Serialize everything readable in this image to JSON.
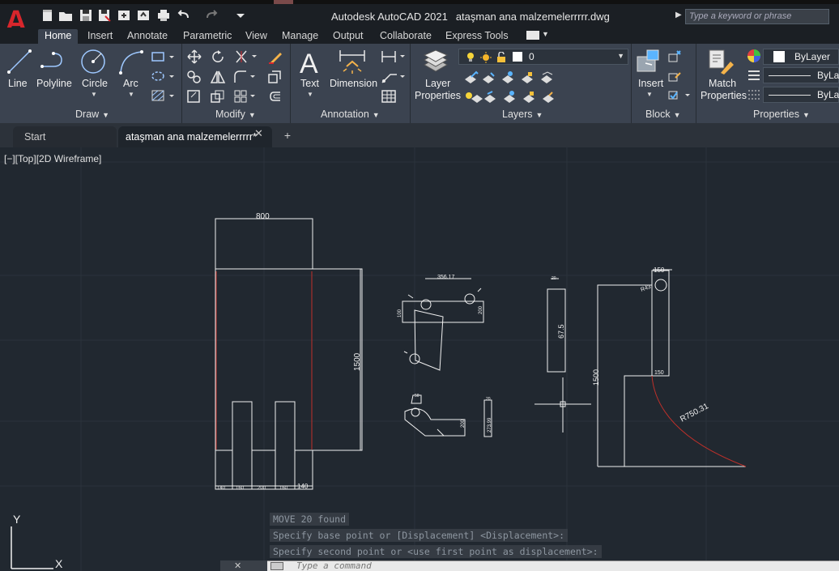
{
  "app": {
    "logo": "A",
    "title": "Autodesk AutoCAD 2021",
    "filename": "ataşman ana malzemelerrrrr.dwg",
    "search_placeholder": "Type a keyword or phrase"
  },
  "ribbon_tabs": [
    "Home",
    "Insert",
    "Annotate",
    "Parametric",
    "View",
    "Manage",
    "Output",
    "Collaborate",
    "Express Tools"
  ],
  "panels": {
    "draw": {
      "title": "Draw",
      "tools": [
        "Line",
        "Polyline",
        "Circle",
        "Arc"
      ]
    },
    "modify": {
      "title": "Modify"
    },
    "annotation": {
      "title": "Annotation",
      "tools": [
        "Text",
        "Dimension"
      ]
    },
    "layers": {
      "title": "Layers",
      "tool_line1": "Layer",
      "tool_line2": "Properties",
      "current_layer": "0"
    },
    "block": {
      "title": "Block",
      "tool": "Insert"
    },
    "properties": {
      "title": "Properties",
      "tool_line1": "Match",
      "tool_line2": "Properties",
      "color": "ByLayer",
      "linetype": "ByLa",
      "lineweight": "ByLa"
    }
  },
  "doc_tabs": {
    "start": "Start",
    "drawing": "ataşman ana malzemelerrrrr*",
    "close": "✕",
    "add": "+"
  },
  "viewport_label": "[−][Top][2D Wireframe]",
  "drawing_dims": {
    "d800": "800",
    "d1500": "1500",
    "d140a": "140",
    "d160a": "160",
    "d200": "200",
    "d160b": "160",
    "d140b": "140",
    "d356": "356.17",
    "d67_5": "67.5",
    "d150a": "150",
    "d150b": "150",
    "d1500b": "1500",
    "r750": "R750.31",
    "d20a": "20",
    "d20b": "20",
    "d273": "273.99",
    "d200b": "200",
    "d200c": "200",
    "d100": "100",
    "r43": "R43",
    "d50": "50"
  },
  "command_history": [
    "MOVE 20 found",
    "Specify base point or [Displacement] <Displacement>:",
    "Specify second point or <use first point as displacement>:"
  ],
  "command_placeholder": "Type a command",
  "ucs": {
    "x": "X",
    "y": "Y"
  },
  "colors": {
    "accent_red": "#d8262c",
    "canvas": "#212830",
    "ribbon": "#3b4350"
  }
}
